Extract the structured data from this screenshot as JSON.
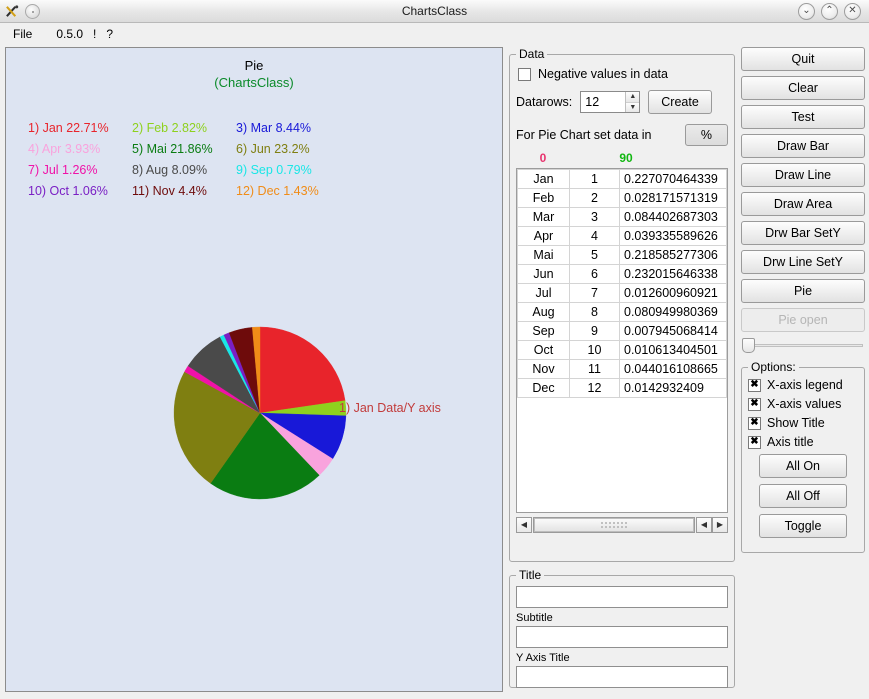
{
  "window": {
    "title": "ChartsClass",
    "minimize_label": "⌄",
    "maximize_label": "⌃",
    "close_label": "✕"
  },
  "menubar": {
    "items": [
      {
        "label": "File"
      },
      {
        "label": "0.5.0"
      },
      {
        "label": "!"
      },
      {
        "label": "?"
      }
    ]
  },
  "chart": {
    "title": "Pie",
    "subtitle": "(ChartsClass)",
    "pointer_label": "1) Jan Data/Y axis",
    "pointer_color": "#c23b3b",
    "subtitle_color": "#0a8a2a",
    "background": "#dde4f2",
    "legend": [
      {
        "label": "1) Jan 22.71%",
        "color": "#e8242b"
      },
      {
        "label": "2) Feb 2.82%",
        "color": "#8ed11e"
      },
      {
        "label": "3) Mar 8.44%",
        "color": "#1818d8"
      },
      {
        "label": "4) Apr 3.93%",
        "color": "#f9a3dd"
      },
      {
        "label": "5) Mai 21.86%",
        "color": "#0a7c12"
      },
      {
        "label": "6) Jun 23.2%",
        "color": "#7f7f11"
      },
      {
        "label": "7) Jul 1.26%",
        "color": "#f012a8"
      },
      {
        "label": "8) Aug 8.09%",
        "color": "#4a4a4a"
      },
      {
        "label": "9) Sep 0.79%",
        "color": "#19e6e6"
      },
      {
        "label": "10) Oct 1.06%",
        "color": "#7a1fc4"
      },
      {
        "label": "11) Nov 4.4%",
        "color": "#6e0b0b"
      },
      {
        "label": "12) Dec 1.43%",
        "color": "#f08c18"
      }
    ]
  },
  "chart_data": {
    "type": "pie",
    "title": "Pie",
    "subtitle": "(ChartsClass)",
    "categories": [
      "Jan",
      "Feb",
      "Mar",
      "Apr",
      "Mai",
      "Jun",
      "Jul",
      "Aug",
      "Sep",
      "Oct",
      "Nov",
      "Dec"
    ],
    "values": [
      0.227070464339,
      0.028171571319,
      0.084402687303,
      0.039335589626,
      0.218585277306,
      0.232015646338,
      0.012600960921,
      0.080949980369,
      0.007945068414,
      0.010613404501,
      0.044016108665,
      0.0142932409
    ],
    "percents": [
      22.71,
      2.82,
      8.44,
      3.93,
      21.86,
      23.2,
      1.26,
      8.09,
      0.79,
      1.06,
      4.4,
      1.43
    ],
    "colors": [
      "#e8242b",
      "#8ed11e",
      "#1818d8",
      "#f9a3dd",
      "#0a7c12",
      "#7f7f11",
      "#f012a8",
      "#4a4a4a",
      "#19e6e6",
      "#7a1fc4",
      "#6e0b0b",
      "#f08c18"
    ],
    "start_angle": 0,
    "direction": "clockwise",
    "legend_position": "top-left",
    "annotations": [
      "1) Jan Data/Y axis"
    ]
  },
  "data_panel": {
    "group_label": "Data",
    "negative_checkbox_label": "Negative values in data",
    "negative_checked": false,
    "datarows_label": "Datarows:",
    "datarows_value": "12",
    "spin_up": "▲",
    "spin_down": "▼",
    "create_label": "Create",
    "pie_set_label": "For Pie Chart set data in",
    "percent_label": "%",
    "col_header_left": "0",
    "col_header_right": "90",
    "col_header_left_color": "#e8336e",
    "col_header_right_color": "#12b712",
    "rows": [
      {
        "month": "Jan",
        "index": "1",
        "value": "0.227070464339"
      },
      {
        "month": "Feb",
        "index": "2",
        "value": "0.028171571319"
      },
      {
        "month": "Mar",
        "index": "3",
        "value": "0.084402687303"
      },
      {
        "month": "Apr",
        "index": "4",
        "value": "0.039335589626"
      },
      {
        "month": "Mai",
        "index": "5",
        "value": "0.218585277306"
      },
      {
        "month": "Jun",
        "index": "6",
        "value": "0.232015646338"
      },
      {
        "month": "Jul",
        "index": "7",
        "value": "0.012600960921"
      },
      {
        "month": "Aug",
        "index": "8",
        "value": "0.080949980369"
      },
      {
        "month": "Sep",
        "index": "9",
        "value": "0.007945068414"
      },
      {
        "month": "Oct",
        "index": "10",
        "value": "0.010613404501"
      },
      {
        "month": "Nov",
        "index": "11",
        "value": "0.044016108665"
      },
      {
        "month": "Dec",
        "index": "12",
        "value": "0.0142932409"
      }
    ],
    "scroll_left": "◀",
    "scroll_right": "▶"
  },
  "title_panel": {
    "group_label": "Title",
    "title_value": "",
    "subtitle_label": "Subtitle",
    "subtitle_value": "",
    "yaxis_label": "Y Axis Title",
    "yaxis_value": ""
  },
  "actions": {
    "buttons": [
      {
        "label": "Quit",
        "disabled": false
      },
      {
        "label": "Clear",
        "disabled": false
      },
      {
        "label": "Test",
        "disabled": false
      },
      {
        "label": "Draw Bar",
        "disabled": false
      },
      {
        "label": "Draw Line",
        "disabled": false
      },
      {
        "label": "Draw Area",
        "disabled": false
      },
      {
        "label": "Drw Bar SetY",
        "disabled": false
      },
      {
        "label": "Drw Line SetY",
        "disabled": false
      },
      {
        "label": "Pie",
        "disabled": false
      },
      {
        "label": "Pie open",
        "disabled": true
      }
    ]
  },
  "options": {
    "group_label": "Options:",
    "checkboxes": [
      {
        "label": "X-axis legend",
        "checked": true
      },
      {
        "label": "X-axis values",
        "checked": true
      },
      {
        "label": "Show Title",
        "checked": true
      },
      {
        "label": "Axis title",
        "checked": true
      }
    ],
    "buttons": [
      {
        "label": "All On"
      },
      {
        "label": "All Off"
      },
      {
        "label": "Toggle"
      }
    ]
  }
}
